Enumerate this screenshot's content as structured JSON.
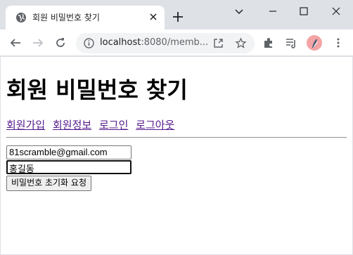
{
  "tab": {
    "title": "회원 비밀번호 찾기"
  },
  "address_bar": {
    "host": "localhost",
    "rest": ":8080/memb..."
  },
  "page": {
    "heading": "회원 비밀번호 찾기",
    "nav_links": [
      "회원가입",
      "회원정보",
      "로그인",
      "로그아웃"
    ],
    "email_value": "81scramble@gmail.com",
    "name_value": "홍길동",
    "submit_label": "비밀번호 초기화 요청"
  },
  "colors": {
    "frame": "#dee1e6",
    "link_visited": "#551a8b",
    "avatar": "#f4a4a4"
  }
}
